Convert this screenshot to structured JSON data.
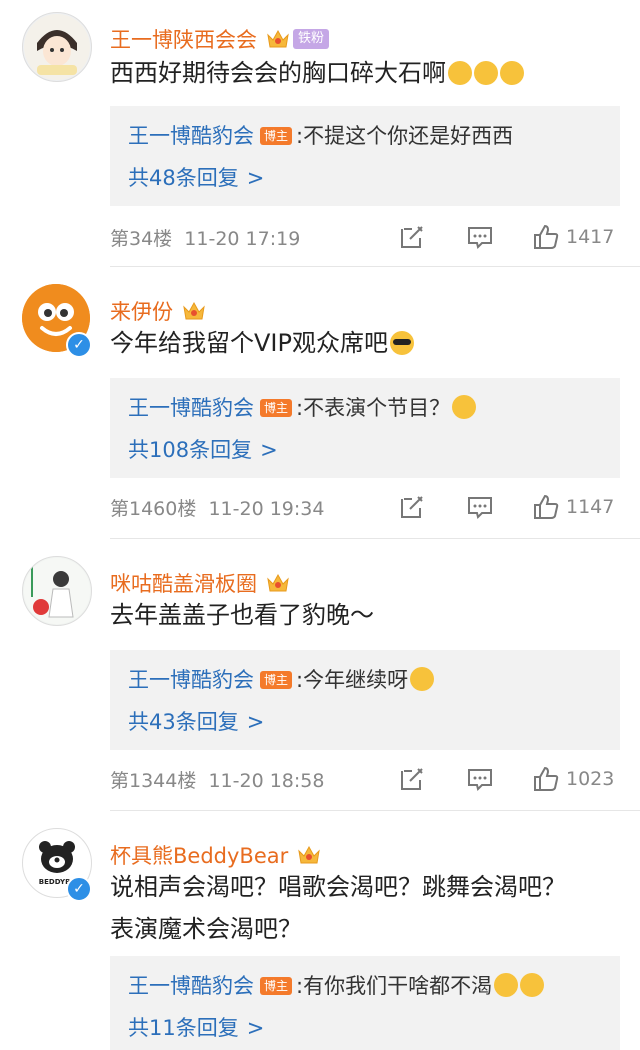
{
  "comments": [
    {
      "username": "王一博陕西会会",
      "fan_badge": "铁粉",
      "text": "西西好期待会会的胸口碎大石啊",
      "reply": {
        "author": "王一博酷豹会",
        "badge": "博主",
        "text": ":不提这个你还是好西西",
        "count_label": "共48条回复"
      },
      "floor": "第34楼",
      "time": "11-20 17:19",
      "likes": "1417"
    },
    {
      "username": "来伊份",
      "text": "今年给我留个VIP观众席吧",
      "reply": {
        "author": "王一博酷豹会",
        "badge": "博主",
        "text": ":不表演个节目？",
        "count_label": "共108条回复"
      },
      "floor": "第1460楼",
      "time": "11-20 19:34",
      "likes": "1147"
    },
    {
      "username": "咪咕酷盖滑板圈",
      "text": "去年盖盖子也看了豹晚～",
      "reply": {
        "author": "王一博酷豹会",
        "badge": "博主",
        "text": ":今年继续呀",
        "count_label": "共43条回复"
      },
      "floor": "第1344楼",
      "time": "11-20 18:58",
      "likes": "1023"
    },
    {
      "username": "杯具熊BeddyBear",
      "text_line1": "说相声会渴吧？唱歌会渴吧？跳舞会渴吧？",
      "text_line2": "表演魔术会渴吧？",
      "reply": {
        "author": "王一博酷豹会",
        "badge": "博主",
        "text": ":有你我们干啥都不渴",
        "count_label": "共11条回复"
      }
    }
  ],
  "chevron": ">",
  "colors": {
    "username": "#e86c1f",
    "link": "#2c6fba",
    "host_badge": "#f47a2b",
    "reply_bg": "#f2f2f2",
    "meta": "#888888"
  },
  "icons": [
    "share-icon",
    "comment-icon",
    "like-icon",
    "crown-icon",
    "verified-icon"
  ]
}
